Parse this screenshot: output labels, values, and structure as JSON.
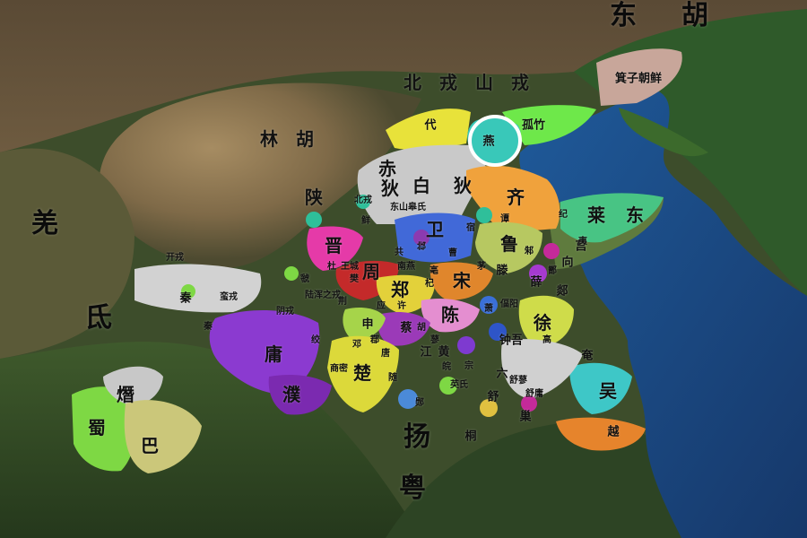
{
  "colors": {
    "sea": "#1d4e8a",
    "land_dark": "#3e4f2c",
    "plateau": "#8b7550",
    "highlight": "#ffffff"
  },
  "regions": {
    "dong_hu": "东　胡",
    "bei_rong": "北　戎　山　戎",
    "lin_hu": "林　胡",
    "qiang": "羌",
    "di": "氐",
    "yue": "粤",
    "yang": "扬"
  },
  "states": {
    "yan": "燕",
    "qi": "齐",
    "lu": "鲁",
    "wei": "卫",
    "jin": "晋",
    "zhou": "周",
    "zheng": "郑",
    "song": "宋",
    "chen": "陈",
    "chu": "楚",
    "shu": "蜀",
    "ba": "巴",
    "dai": "代",
    "yong": "庸",
    "pu": "濮",
    "qin": "秦",
    "shen": "申",
    "cai": "蔡",
    "xu": "徐",
    "wu": "吴",
    "yue_state": "越",
    "lai": "莱",
    "dong": "东",
    "ju": "莒",
    "xi": "熸",
    "ji_zi_chao_xian": "箕子朝鲜",
    "gu_zhu": "孤竹",
    "chi": "赤",
    "di_tribe": "狄",
    "bai": "白",
    "ling_zhi": "令支",
    "jiang": "江",
    "huang": "黄",
    "liu": "六",
    "tong": "桐",
    "shu_state": "舒",
    "chao": "巢",
    "yan_south": "奄",
    "zhongwu": "钟吾",
    "teng": "滕",
    "xue": "薛",
    "tan": "郯",
    "xiang": "向"
  },
  "small_labels": {
    "dongshan_gaoshi": "东山皋氏",
    "beirong": "北戎",
    "lu_rong": "陆浑之戎",
    "yin_rong": "阴戎",
    "yi_luo": "伊洛之戎",
    "man_rong": "蛮戎",
    "kai_rong": "开戎",
    "xu_small": "许",
    "ying": "应",
    "jing": "荆",
    "ruo": "鄀",
    "tang": "唐",
    "sui": "随",
    "yun": "郧",
    "deng": "邓",
    "jiao": "绞",
    "qin_small": "秦",
    "gui": "虢",
    "xian": "鲜",
    "cao": "曹",
    "qi_small": "杞",
    "zhu": "邾",
    "su": "宿",
    "tan2": "谭",
    "ji": "纪",
    "yi": "夷",
    "wan": "皖",
    "zong": "宗",
    "liao": "蓼",
    "hu": "胡",
    "shen2": "沈",
    "xiao": "萧",
    "bi": "偪阳",
    "zeng": "鄫",
    "mao": "茅",
    "shu_liao": "舒蓼",
    "ying2": "英氏",
    "hu_state": "胡",
    "shangmi": "商密",
    "fan": "樊",
    "bei": "邶",
    "gong": "共",
    "zhurong": "王城",
    "du": "杜",
    "lai_small": "崇",
    "nan_yan": "南燕",
    "bo": "亳",
    "shu_yong": "舒庸",
    "gao": "高",
    "you": "犹",
    "liu2": "蓼"
  }
}
